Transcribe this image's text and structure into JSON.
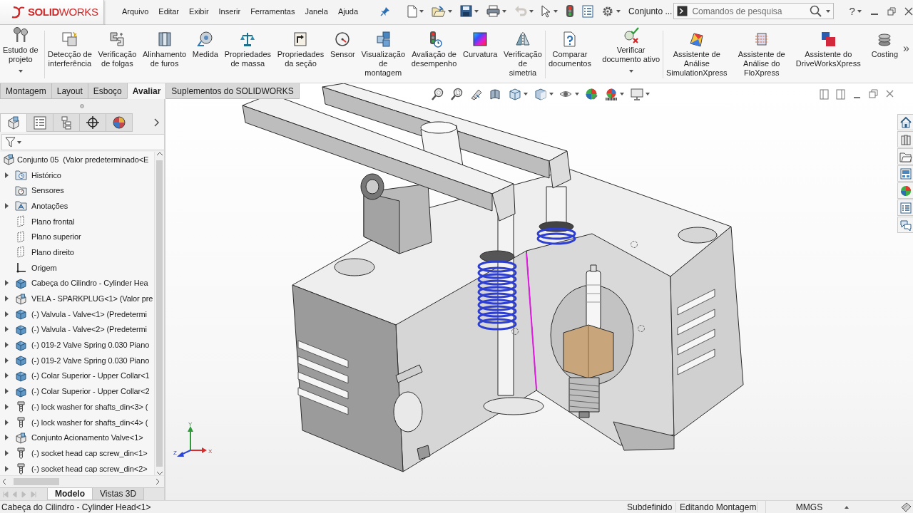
{
  "titlebar": {
    "logo": "**SOLID**WORKS",
    "menus": [
      "Arquivo",
      "Editar",
      "Exibir",
      "Inserir",
      "Ferramentas",
      "Janela",
      "Ajuda"
    ],
    "quick_access": [
      {
        "dropdown": true,
        "disabled": false
      },
      {
        "dropdown": true,
        "disabled": false
      },
      {
        "dropdown": true,
        "disabled": false
      },
      {
        "dropdown": true,
        "disabled": false
      },
      {
        "dropdown": true,
        "disabled": true
      },
      {
        "dropdown": true,
        "disabled": false
      },
      {
        "dropdown": false,
        "disabled": false
      },
      {
        "dropdown": false,
        "disabled": false
      },
      {
        "dropdown": true,
        "disabled": false
      }
    ],
    "document": "Conjunto ...",
    "search": {
      "placeholder": "Comandos de pesquisa"
    },
    "help": "?"
  },
  "ribbon": {
    "groups": [
      {
        "items": [
          {
            "label": "Estudo de\nprojeto",
            "dropdown": true
          }
        ]
      },
      {
        "items": [
          {
            "label": "Detecção de\ninterferência",
            "dropdown": false
          },
          {
            "label": "Verificação\nde folgas",
            "dropdown": false
          },
          {
            "label": "Alinhamento\nde furos",
            "dropdown": false
          },
          {
            "label": "Medida",
            "dropdown": false
          },
          {
            "label": "Propriedades\nde massa",
            "dropdown": false
          },
          {
            "label": "Propriedades\nda seção",
            "dropdown": false
          },
          {
            "label": "Sensor",
            "dropdown": false
          },
          {
            "label": "Visualização\nde\nmontagem",
            "dropdown": false
          },
          {
            "label": "Avaliação de\ndesempenho",
            "dropdown": false
          },
          {
            "label": "Curvatura",
            "dropdown": false
          },
          {
            "label": "Verificação\nde\nsimetria",
            "dropdown": false
          }
        ]
      },
      {
        "items": [
          {
            "label": "Comparar\ndocumentos",
            "dropdown": false
          },
          {
            "label": "Verificar\ndocumento ativo",
            "dropdown": true
          }
        ]
      },
      {
        "items": [
          {
            "label": "Assistente de\nAnálise\nSimulationXpress",
            "dropdown": false
          },
          {
            "label": "Assistente de\nAnálise do\nFloXpress",
            "dropdown": false
          },
          {
            "label": "Assistente do\nDriveWorksXpress",
            "dropdown": false
          },
          {
            "label": "Costing",
            "dropdown": false
          }
        ]
      }
    ],
    "overflow": "»"
  },
  "command_tabs": [
    {
      "label": "Montagem",
      "selected": false
    },
    {
      "label": "Layout",
      "selected": false
    },
    {
      "label": "Esboço",
      "selected": false
    },
    {
      "label": "Avaliar",
      "selected": true
    },
    {
      "label": "Suplementos do SOLIDWORKS",
      "selected": false
    }
  ],
  "feature_manager": {
    "panel_tabs": [
      {
        "selected": true
      },
      {
        "selected": false
      },
      {
        "selected": false
      },
      {
        "selected": false
      },
      {
        "selected": false
      }
    ],
    "tree": {
      "label": "Conjunto 05  (Valor predeterminado<E",
      "kind": "assembly",
      "children": [
        {
          "label": "Histórico",
          "kind": "history",
          "expanded": false
        },
        {
          "label": "Sensores",
          "kind": "sensors"
        },
        {
          "label": "Anotações",
          "kind": "annotations",
          "expanded": false
        },
        {
          "label": "Plano frontal",
          "kind": "plane"
        },
        {
          "label": "Plano superior",
          "kind": "plane"
        },
        {
          "label": "Plano direito",
          "kind": "plane"
        },
        {
          "label": "Origem",
          "kind": "origin"
        },
        {
          "label": "Cabeça do Cilindro - Cylinder Hea",
          "kind": "part",
          "expanded": false
        },
        {
          "label": "VELA - SPARKPLUG<1> (Valor pre",
          "kind": "assembly",
          "expanded": false
        },
        {
          "label": "(-) Valvula - Valve<1> (Predetermi",
          "kind": "part",
          "expanded": false
        },
        {
          "label": "(-) Valvula - Valve<2> (Predetermi",
          "kind": "part",
          "expanded": false
        },
        {
          "label": "(-) 019-2 Valve Spring 0.030 Piano",
          "kind": "part",
          "expanded": false
        },
        {
          "label": "(-) 019-2 Valve Spring 0.030 Piano",
          "kind": "part",
          "expanded": false
        },
        {
          "label": "(-) Colar Superior - Upper Collar<1",
          "kind": "part",
          "expanded": false
        },
        {
          "label": "(-) Colar Superior - Upper Collar<2",
          "kind": "part",
          "expanded": false
        },
        {
          "label": "(-) lock washer for shafts_din<3> (",
          "kind": "fastener",
          "expanded": false
        },
        {
          "label": "(-) lock washer for shafts_din<4> (",
          "kind": "fastener",
          "expanded": false
        },
        {
          "label": "Conjunto Acionamento Valve<1>",
          "kind": "assembly",
          "expanded": false
        },
        {
          "label": "(-) socket head cap screw_din<1>",
          "kind": "fastener",
          "expanded": false
        },
        {
          "label": "(-) socket head cap screw_din<2>",
          "kind": "fastener",
          "expanded": false
        }
      ]
    },
    "nav_buttons": [
      {
        "disabled": true
      },
      {
        "disabled": true
      },
      {
        "disabled": true
      },
      {
        "disabled": true
      }
    ],
    "bottom_tabs": [
      {
        "label": "Modelo",
        "selected": true
      },
      {
        "label": "Vistas 3D",
        "selected": false
      }
    ]
  },
  "viewport": {
    "heads_up": [
      {
        "dropdown": false
      },
      {
        "dropdown": false
      },
      {
        "dropdown": false
      },
      {
        "dropdown": false
      },
      {
        "dropdown": true
      },
      {
        "dropdown": true
      },
      {
        "dropdown": true
      },
      {
        "dropdown": false
      },
      {
        "dropdown": true
      },
      {
        "dropdown": true
      }
    ],
    "triad": {
      "x": "X",
      "y": "Y",
      "z": "Z"
    }
  },
  "status_bar": {
    "selection": "Cabeça do Cilindro - Cylinder Head<1>",
    "fields": [
      "Subdefinido",
      "Editando Montagem",
      "MMGS"
    ]
  }
}
